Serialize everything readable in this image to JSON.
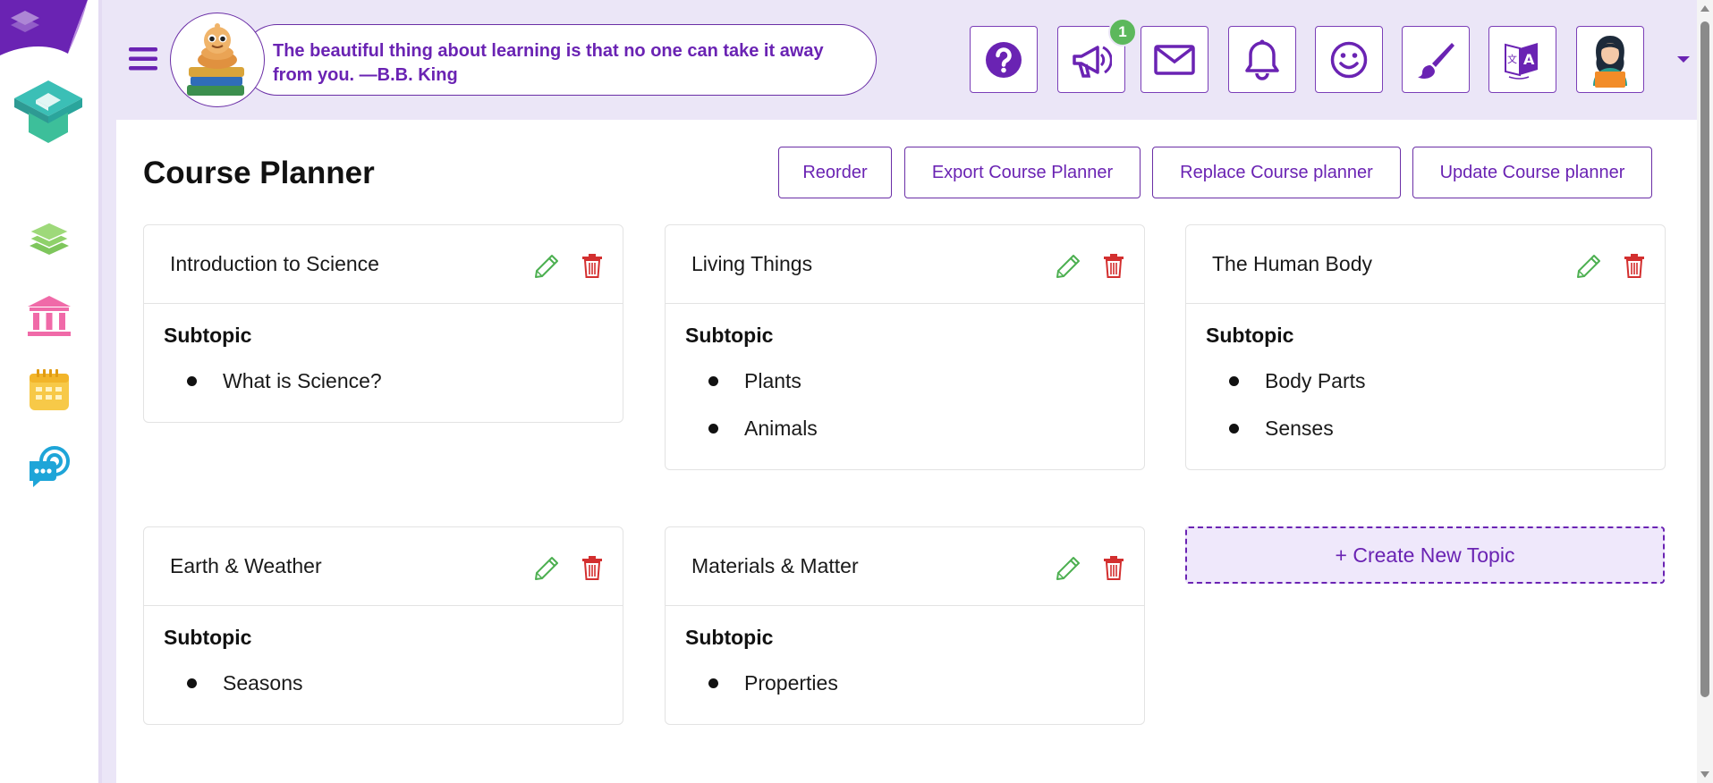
{
  "header": {
    "quote": "The beautiful thing about learning is that no one can take it away from you. —B.B. King",
    "notification_count": "1"
  },
  "page": {
    "title": "Course Planner",
    "actions": {
      "reorder": "Reorder",
      "export": "Export Course Planner",
      "replace": "Replace Course planner",
      "update": "Update Course planner"
    },
    "subtopic_label": "Subtopic",
    "create_label": "+ Create New Topic"
  },
  "topics": [
    {
      "title": "Introduction to Science",
      "subtopics": [
        "What is Science?"
      ]
    },
    {
      "title": "Living Things",
      "subtopics": [
        "Plants",
        "Animals"
      ]
    },
    {
      "title": "The Human Body",
      "subtopics": [
        "Body Parts",
        "Senses"
      ]
    },
    {
      "title": "Earth & Weather",
      "subtopics": [
        "Seasons"
      ]
    },
    {
      "title": "Materials & Matter",
      "subtopics": [
        "Properties"
      ]
    }
  ],
  "colors": {
    "brand": "#6a23b3",
    "edit": "#4caf50",
    "delete": "#d32f2f",
    "badge": "#5cb85c"
  },
  "icons": {
    "sidebar": [
      "books-icon",
      "institution-icon",
      "calendar-icon",
      "chat-support-icon"
    ],
    "header": [
      "help-icon",
      "announcement-icon",
      "mail-icon",
      "bell-icon",
      "smiley-icon",
      "paintbrush-icon",
      "translate-icon",
      "avatar"
    ]
  }
}
